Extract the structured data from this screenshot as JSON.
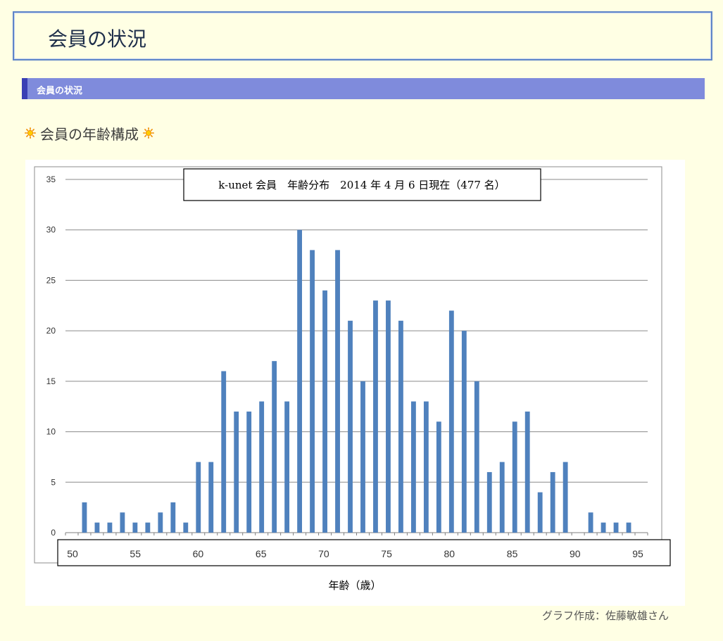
{
  "header": {
    "title": "会員の状況"
  },
  "section": {
    "label": "会員の状況"
  },
  "subheading": {
    "text": "会員の年齢構成"
  },
  "credit": {
    "text": "グラフ作成：佐藤敏雄さん"
  },
  "colors": {
    "bar": "#4f81bd",
    "section_bar": "#7f8bdc",
    "section_accent": "#3a3fb4",
    "background": "#ffffe4"
  },
  "icons": {
    "left": "sun-icon",
    "right": "sun-icon"
  },
  "chart_data": {
    "type": "bar",
    "title": "k-unet 会員　年齢分布　2014 年 4 月 6 日現在（477 名）",
    "xlabel": "年齢（歳）",
    "ylabel": "",
    "ylim": [
      0,
      35
    ],
    "yticks": [
      0,
      5,
      10,
      15,
      20,
      25,
      30,
      35
    ],
    "xticks": [
      50,
      55,
      60,
      65,
      70,
      75,
      80,
      85,
      90,
      95
    ],
    "xlim": [
      50,
      95
    ],
    "grid": true,
    "x": [
      50,
      51,
      52,
      53,
      54,
      55,
      56,
      57,
      58,
      59,
      60,
      61,
      62,
      63,
      64,
      65,
      66,
      67,
      68,
      69,
      70,
      71,
      72,
      73,
      74,
      75,
      76,
      77,
      78,
      79,
      80,
      81,
      82,
      83,
      84,
      85,
      86,
      87,
      88,
      89,
      90,
      91,
      92,
      93,
      94,
      95
    ],
    "values": [
      0,
      3,
      1,
      1,
      2,
      1,
      1,
      2,
      3,
      1,
      7,
      7,
      16,
      12,
      12,
      13,
      17,
      13,
      30,
      28,
      24,
      28,
      21,
      15,
      23,
      23,
      21,
      13,
      13,
      11,
      22,
      20,
      15,
      6,
      7,
      11,
      12,
      4,
      6,
      7,
      0,
      2,
      1,
      1,
      1,
      0
    ]
  }
}
